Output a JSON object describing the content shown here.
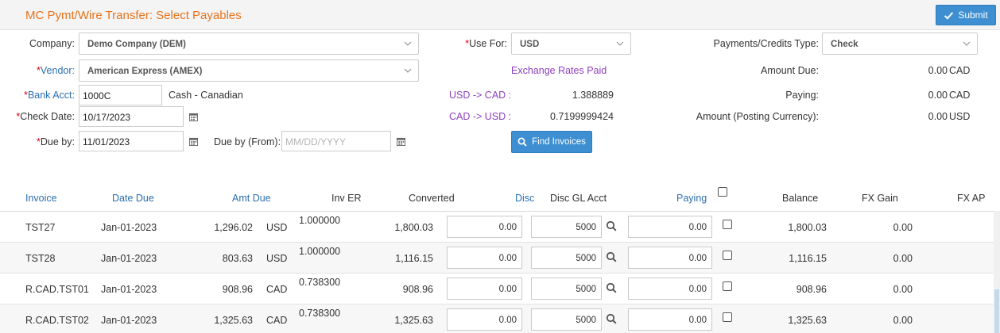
{
  "header": {
    "title": "MC Pymt/Wire Transfer: Select Payables",
    "submit_label": "Submit"
  },
  "form": {
    "company_label": "Company:",
    "company_value": "Demo Company (DEM)",
    "vendor_label": "Vendor:",
    "vendor_value": "American Express (AMEX)",
    "bank_label": "Bank Acct:",
    "bank_value": "1000C",
    "bank_desc": "Cash - Canadian",
    "check_date_label": "Check Date:",
    "check_date_value": "10/17/2023",
    "due_by_label": "Due by:",
    "due_by_value": "11/01/2023",
    "due_from_label": "Due by (From):",
    "due_from_placeholder": "MM/DD/YYYY",
    "use_for_label": "Use For:",
    "use_for_value": "USD",
    "exchange_title": "Exchange Rates Paid",
    "rate1_label": "USD -> CAD :",
    "rate1_value": "1.388889",
    "rate2_label": "CAD -> USD :",
    "rate2_value": "0.7199999424",
    "find_label": "Find Invoices",
    "pay_type_label": "Payments/Credits Type:",
    "pay_type_value": "Check",
    "amount_due_label": "Amount Due:",
    "amount_due_value": "0.00",
    "amount_due_cur": "CAD",
    "paying_label": "Paying:",
    "paying_value": "0.00",
    "paying_cur": "CAD",
    "posting_label": "Amount (Posting Currency):",
    "posting_value": "0.00",
    "posting_cur": "USD"
  },
  "grid": {
    "headers": {
      "invoice": "Invoice",
      "date_due": "Date Due",
      "amt_due": "Amt Due",
      "inv_er": "Inv ER",
      "converted": "Converted",
      "disc": "Disc",
      "disc_gl": "Disc GL Acct",
      "paying": "Paying",
      "balance": "Balance",
      "fx_gain": "FX Gain",
      "fx_ap": "FX AP"
    },
    "rows": [
      {
        "invoice": "TST27",
        "date_due": "Jan-01-2023",
        "amt_due": "1,296.02",
        "currency": "USD",
        "inv_er": "1.000000",
        "converted": "1,800.03",
        "disc": "0.00",
        "disc_gl": "5000",
        "paying": "0.00",
        "balance": "1,800.03",
        "fx_gain": "0.00"
      },
      {
        "invoice": "TST28",
        "date_due": "Jan-01-2023",
        "amt_due": "803.63",
        "currency": "USD",
        "inv_er": "1.000000",
        "converted": "1,116.15",
        "disc": "0.00",
        "disc_gl": "5000",
        "paying": "0.00",
        "balance": "1,116.15",
        "fx_gain": "0.00"
      },
      {
        "invoice": "R.CAD.TST01",
        "date_due": "Jan-01-2023",
        "amt_due": "908.96",
        "currency": "CAD",
        "inv_er": "0.738300",
        "converted": "908.96",
        "disc": "0.00",
        "disc_gl": "5000",
        "paying": "0.00",
        "balance": "908.96",
        "fx_gain": "0.00"
      },
      {
        "invoice": "R.CAD.TST02",
        "date_due": "Jan-01-2023",
        "amt_due": "1,325.63",
        "currency": "CAD",
        "inv_er": "0.738300",
        "converted": "1,325.63",
        "disc": "0.00",
        "disc_gl": "5000",
        "paying": "0.00",
        "balance": "1,325.63",
        "fx_gain": "0.00"
      }
    ]
  },
  "colors": {
    "title": "#e8731c",
    "primary": "#3d8fd1",
    "required": "#d8000c",
    "link": "#2a6fb0",
    "exchange": "#8d3fc0"
  }
}
